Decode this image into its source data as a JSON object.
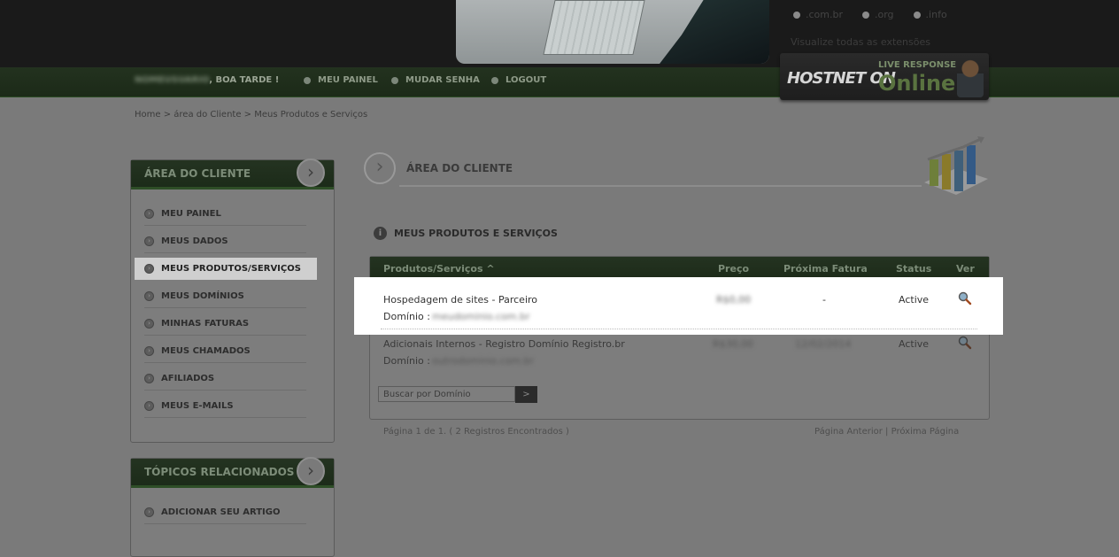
{
  "header": {
    "domain_options": [
      ".com.br",
      ".org",
      ".info"
    ],
    "extensions_link": "Visualize todas as extensões"
  },
  "nav": {
    "user_name": "NOMEUSUARIO",
    "greeting": ", BOA TARDE !",
    "links": [
      "MEU PAINEL",
      "MUDAR SENHA",
      "LOGOUT"
    ]
  },
  "live": {
    "logo": "HOSTNET ON",
    "label": "LIVE RESPONSE",
    "status": "Online"
  },
  "breadcrumb": "Home > área do Cliente > Meus Produtos e Serviços",
  "sidebar": {
    "title": "ÁREA DO CLIENTE",
    "items": [
      {
        "label": "MEU PAINEL"
      },
      {
        "label": "MEUS DADOS"
      },
      {
        "label": "MEUS PRODUTOS/SERVIÇOS"
      },
      {
        "label": "MEUS DOMÍNIOS"
      },
      {
        "label": "MINHAS FATURAS"
      },
      {
        "label": "MEUS CHAMADOS"
      },
      {
        "label": "AFILIADOS"
      },
      {
        "label": "MEUS E-MAILS"
      }
    ],
    "related_title": "TÓPICOS RELACIONADOS",
    "related_items": [
      {
        "label": "ADICIONAR SEU ARTIGO"
      }
    ]
  },
  "main": {
    "title": "ÁREA DO CLIENTE",
    "section_title": "MEUS PRODUTOS E SERVIÇOS",
    "table": {
      "headers": [
        "Produtos/Serviços ^",
        "Preço",
        "Próxima Fatura",
        "Status",
        "Ver"
      ],
      "rows": [
        {
          "product": "Hospedagem de sites - Parceiro",
          "domain_label": "Domínio :",
          "domain": "meudominio.com.br",
          "price": "R$0,00",
          "next_invoice": "-",
          "status": "Active"
        },
        {
          "product": "Adicionais Internos - Registro Domínio Registro.br",
          "domain_label": "Domínio :",
          "domain": "outrodominio.com.br",
          "price": "R$30,00",
          "next_invoice": "12/02/2014",
          "status": "Active"
        }
      ]
    },
    "search_placeholder": "Buscar por Domínio",
    "search_button": ">",
    "pager_info": "Página 1 de 1. ( 2 Registros Encontrados )",
    "pager_prev": "Página Anterior",
    "pager_sep": "|",
    "pager_next": "Próxima Página"
  }
}
